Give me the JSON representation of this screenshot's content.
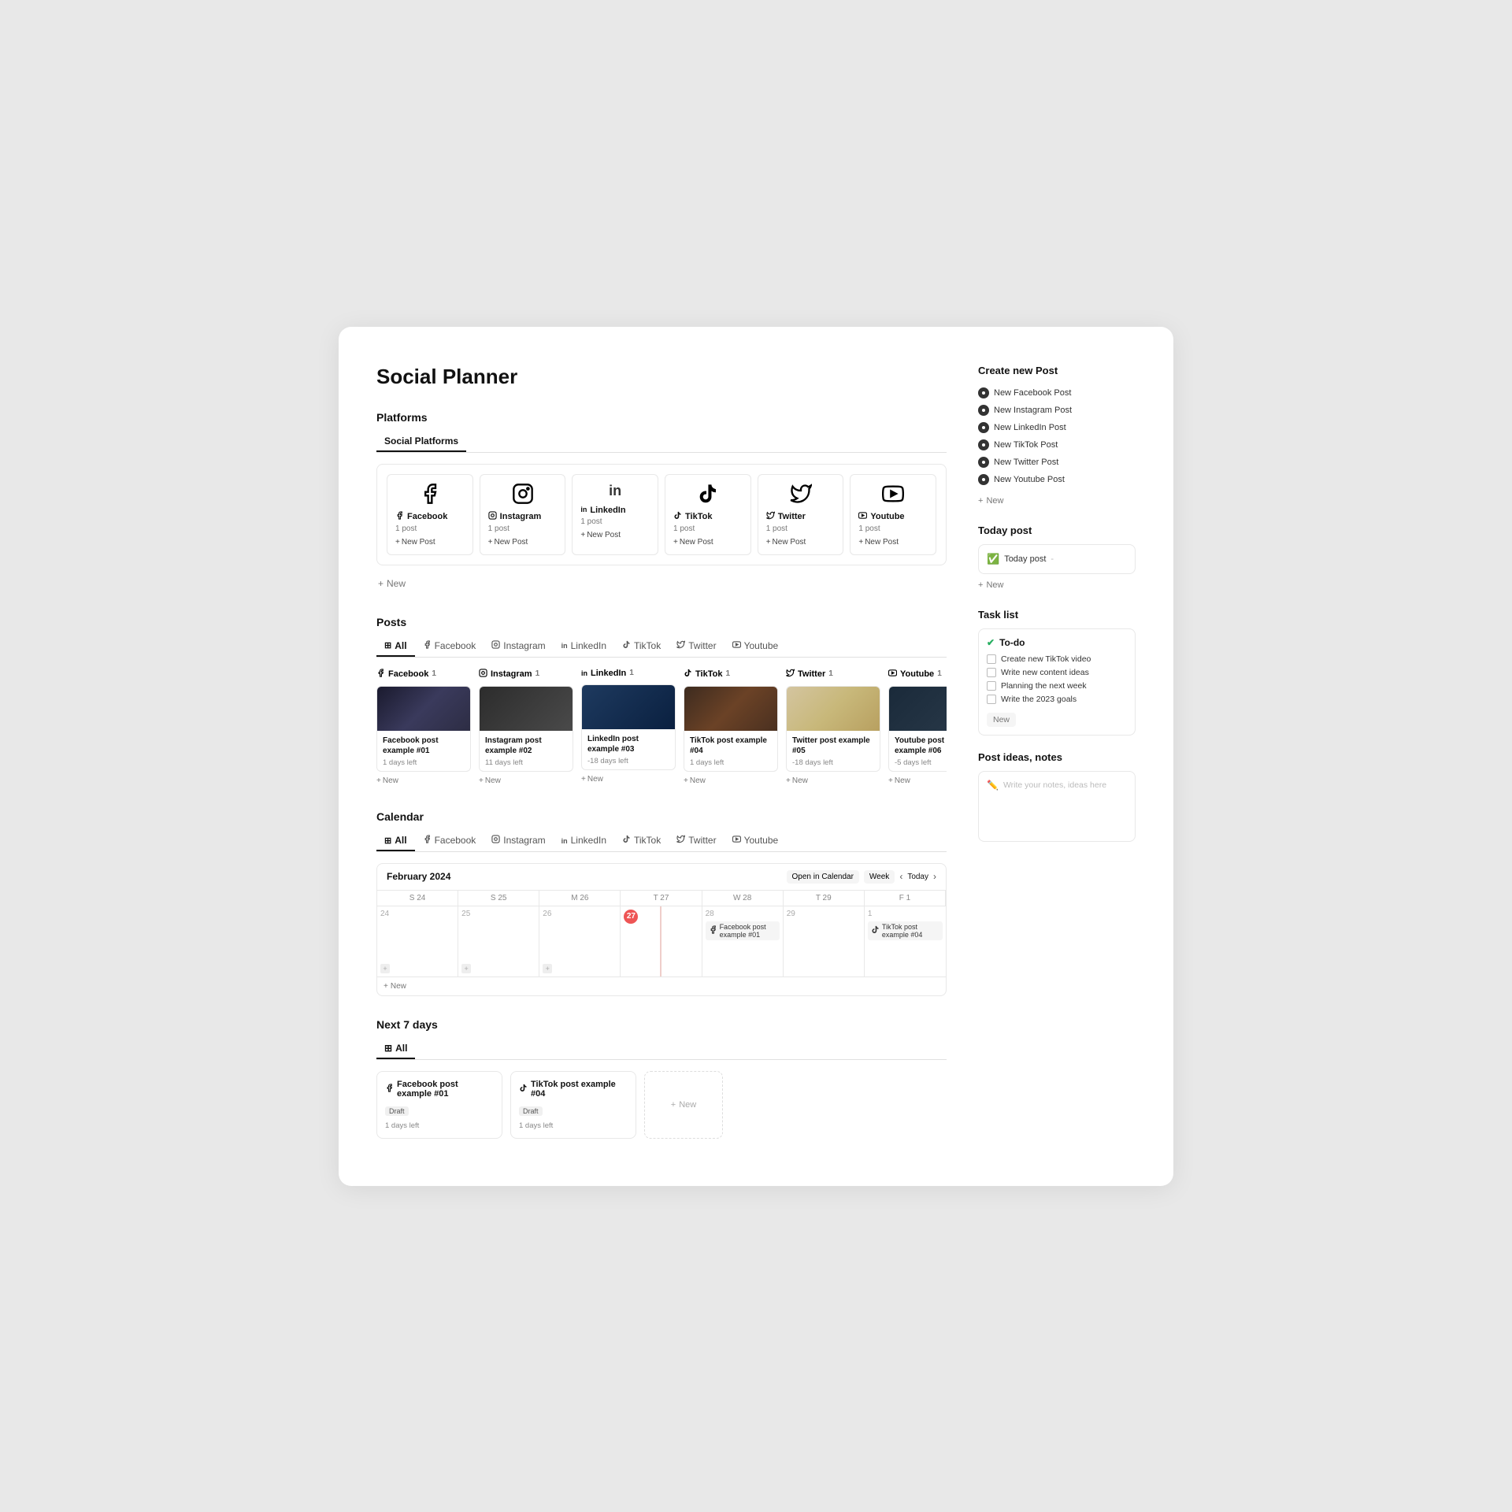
{
  "page": {
    "title": "Social Planner"
  },
  "platforms": {
    "section_title": "Platforms",
    "active_tab": "Social Platforms",
    "tabs": [
      "Social Platforms"
    ],
    "items": [
      {
        "id": "facebook",
        "name": "Facebook",
        "icon": "f",
        "posts": "1 post",
        "new_label": "New Post"
      },
      {
        "id": "instagram",
        "name": "Instagram",
        "icon": "◎",
        "posts": "1 post",
        "new_label": "New Post"
      },
      {
        "id": "linkedin",
        "name": "LinkedIn",
        "icon": "in",
        "posts": "1 post",
        "new_label": "New Post"
      },
      {
        "id": "tiktok",
        "name": "TikTok",
        "icon": "♪",
        "posts": "1 post",
        "new_label": "New Post"
      },
      {
        "id": "twitter",
        "name": "Twitter",
        "icon": "🐦",
        "posts": "1 post",
        "new_label": "New Post"
      },
      {
        "id": "youtube",
        "name": "Youtube",
        "icon": "▶",
        "posts": "1 post",
        "new_label": "New Post"
      }
    ],
    "add_new": "New"
  },
  "posts": {
    "section_title": "Posts",
    "tabs": [
      "All",
      "Facebook",
      "Instagram",
      "LinkedIn",
      "TikTok",
      "Twitter",
      "Youtube"
    ],
    "active_tab": "All",
    "columns": [
      {
        "platform": "Facebook",
        "icon": "f",
        "count": 1,
        "posts": [
          {
            "title": "Facebook post example #01",
            "days": "1 days left",
            "img_class": "img-facebook"
          }
        ]
      },
      {
        "platform": "Instagram",
        "icon": "◎",
        "count": 1,
        "posts": [
          {
            "title": "Instagram post example #02",
            "days": "11 days left",
            "img_class": "img-instagram"
          }
        ]
      },
      {
        "platform": "LinkedIn",
        "icon": "in",
        "count": 1,
        "posts": [
          {
            "title": "LinkedIn post example #03",
            "days": "-18 days left",
            "img_class": "img-linkedin"
          }
        ]
      },
      {
        "platform": "TikTok",
        "icon": "♪",
        "count": 1,
        "posts": [
          {
            "title": "TikTok post example #04",
            "days": "1 days left",
            "img_class": "img-tiktok"
          }
        ]
      },
      {
        "platform": "Twitter",
        "icon": "🐦",
        "count": 1,
        "posts": [
          {
            "title": "Twitter post example #05",
            "days": "-18 days left",
            "img_class": "img-twitter"
          }
        ]
      },
      {
        "platform": "Youtube",
        "icon": "▶",
        "count": 1,
        "posts": [
          {
            "title": "Youtube post example #06",
            "days": "-5 days left",
            "img_class": "img-youtube"
          }
        ]
      }
    ],
    "new_label": "New"
  },
  "calendar": {
    "section_title": "Calendar",
    "tabs": [
      "All",
      "Facebook",
      "Instagram",
      "LinkedIn",
      "TikTok",
      "Twitter",
      "Youtube"
    ],
    "active_tab": "All",
    "month": "February 2024",
    "open_btn": "Open in Calendar",
    "week_btn": "Week",
    "today_btn": "Today",
    "days": [
      {
        "letter": "S",
        "num": 24
      },
      {
        "letter": "S",
        "num": 25
      },
      {
        "letter": "M",
        "num": 26
      },
      {
        "letter": "T",
        "num": 27,
        "today": true
      },
      {
        "letter": "W",
        "num": 28
      },
      {
        "letter": "T",
        "num": 29
      },
      {
        "letter": "F",
        "num": 1
      }
    ],
    "events": [
      {
        "day_index": 4,
        "title": "Facebook post example #01",
        "icon": "f"
      },
      {
        "day_index": 6,
        "title": "TikTok post example #04",
        "icon": "♪"
      }
    ],
    "add_new": "New"
  },
  "next7days": {
    "section_title": "Next 7 days",
    "tab": "All",
    "items": [
      {
        "title": "Facebook post example #01",
        "platform_icon": "f",
        "badge": "Draft",
        "days": "1 days left"
      },
      {
        "title": "TikTok post example #04",
        "platform_icon": "♪",
        "badge": "Draft",
        "days": "1 days left"
      }
    ],
    "new_label": "New"
  },
  "right": {
    "create_post": {
      "title": "Create new Post",
      "items": [
        {
          "label": "New Facebook Post",
          "icon": "filled"
        },
        {
          "label": "New Instagram Post",
          "icon": "filled"
        },
        {
          "label": "New LinkedIn Post",
          "icon": "filled"
        },
        {
          "label": "New TikTok Post",
          "icon": "filled"
        },
        {
          "label": "New Twitter Post",
          "icon": "filled"
        },
        {
          "label": "New Youtube Post",
          "icon": "filled"
        }
      ],
      "new_label": "New"
    },
    "today_post": {
      "title": "Today post",
      "item": "Today post",
      "dash": "-"
    },
    "task_list": {
      "title": "Task list",
      "header": "To-do",
      "tasks": [
        "Create new TikTok video",
        "Write new content ideas",
        "Planning the next week",
        "Write the 2023 goals"
      ],
      "new_label": "New"
    },
    "notes": {
      "title": "Post ideas, notes",
      "placeholder": "Write your notes, ideas here"
    }
  }
}
